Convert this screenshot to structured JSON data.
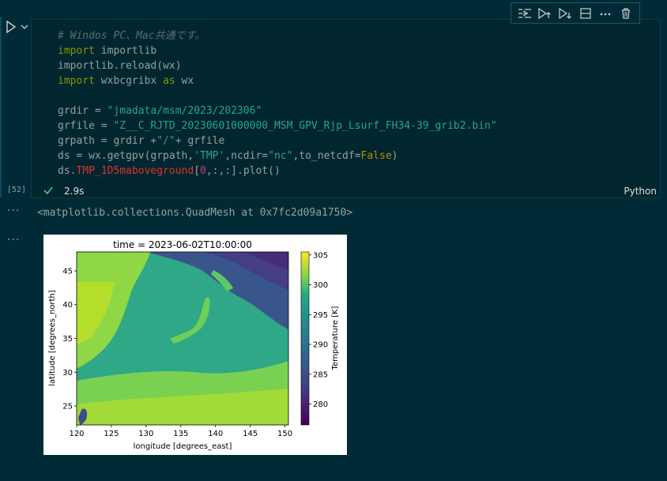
{
  "cell": {
    "execution_count": "[52]",
    "status_time": "2.9s",
    "language": "Python",
    "toolbar": [
      "run-by-line",
      "execute-above",
      "execute-below",
      "split-cell",
      "more",
      "delete"
    ],
    "code": {
      "l1": "# Windos PC、Mac共通です。",
      "l2_kw": "import",
      "l2_rest": " importlib",
      "l3": "importlib.reload(wx)",
      "l4_kw": "import",
      "l4_mid": " wxbcgribx ",
      "l4_kw2": "as",
      "l4_rest": " wx",
      "l6_a": "grdir = ",
      "l6_s": "\"jmadata/msm/2023/202306\"",
      "l7_a": "grfile = ",
      "l7_s": "\"Z__C_RJTD_20230601000000_MSM_GPV_Rjp_Lsurf_FH34-39_grib2.bin\"",
      "l8_a": "grpath = grdir +",
      "l8_s": "\"/\"",
      "l8_b": "+ grfile",
      "l9_a": "ds = wx.getgpv(grpath,",
      "l9_s1": "'TMP'",
      "l9_b": ",ncdir=",
      "l9_s2": "\"nc\"",
      "l9_c": ",to_netcdf=",
      "l9_kw": "False",
      "l9_d": ")",
      "l10_a": "ds.",
      "l10_r": "TMP_1D5maboveground",
      "l10_b": "[",
      "l10_n": "0",
      "l10_c": ",:,:].plot()"
    }
  },
  "output1": {
    "text": "<matplotlib.collections.QuadMesh at 0x7fc2d09a1750>",
    "dots": "···"
  },
  "output2": {
    "dots": "···"
  },
  "chart_data": {
    "type": "heatmap",
    "title": "time = 2023-06-02T10:00:00",
    "xlabel": "longitude [degrees_east]",
    "ylabel": "latitude [degrees_north]",
    "colorbar_label": "Temperature [K]",
    "colormap": "viridis",
    "xlim": [
      120,
      150.5
    ],
    "ylim": [
      22.2,
      47.8
    ],
    "zlim": [
      276.5,
      305.5
    ],
    "x_ticks": [
      120,
      125,
      130,
      135,
      140,
      145,
      150
    ],
    "y_ticks": [
      25,
      30,
      35,
      40,
      45
    ],
    "colorbar_ticks": [
      280,
      285,
      290,
      295,
      300,
      305
    ]
  }
}
